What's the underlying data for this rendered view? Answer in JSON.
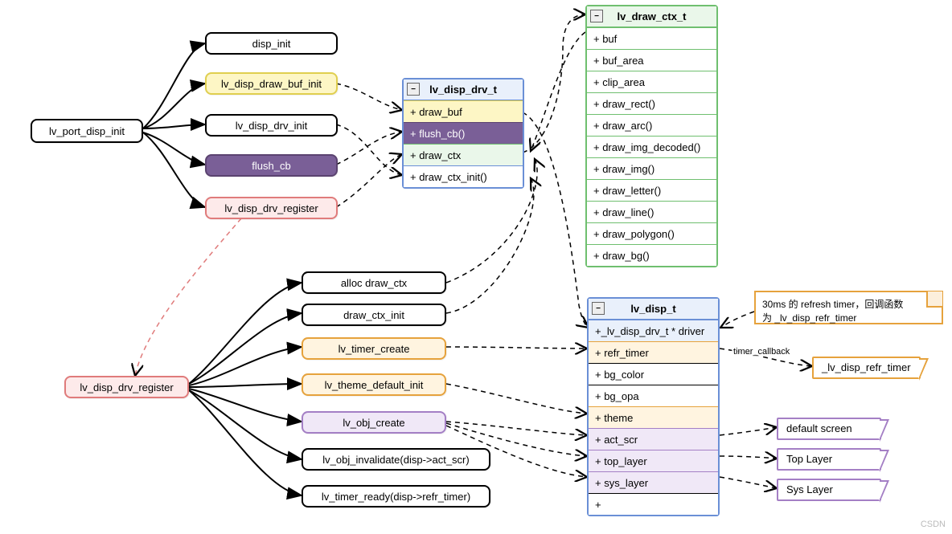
{
  "left_root": "lv_port_disp_init",
  "left_children": [
    {
      "label": "disp_init",
      "fill": "#fff",
      "border": "#000"
    },
    {
      "label": "lv_disp_draw_buf_init",
      "fill": "#fdf6c5",
      "border": "#e0cf4f"
    },
    {
      "label": "lv_disp_drv_init",
      "fill": "#fff",
      "border": "#000"
    },
    {
      "label": "flush_cb",
      "fill": "#7a5f97",
      "border": "#5b4370",
      "text": "#fff"
    },
    {
      "label": "lv_disp_drv_register",
      "fill": "#fdeaea",
      "border": "#e07b7b"
    }
  ],
  "drv_class": {
    "title": "lv_disp_drv_t",
    "border": "#6a8fd6",
    "rows": [
      {
        "label": "+ draw_buf",
        "fill": "#fdf6c5",
        "border": "#e0cf4f"
      },
      {
        "label": "+ flush_cb()",
        "fill": "#7a5f97",
        "border": "#5b4370",
        "text": "#fff"
      },
      {
        "label": "+ draw_ctx",
        "fill": "#eaf7ea",
        "border": "#6fbf6f"
      },
      {
        "label": "+ draw_ctx_init()",
        "fill": "#fff",
        "border": "#6a8fd6"
      }
    ]
  },
  "draw_ctx_class": {
    "title": "lv_draw_ctx_t",
    "border": "#6fbf6f",
    "rows": [
      "+ buf",
      "+ buf_area",
      "+ clip_area",
      "+ draw_rect()",
      "+ draw_arc()",
      "+ draw_img_decoded()",
      "+ draw_img()",
      "+ draw_letter()",
      "+ draw_line()",
      "+ draw_polygon()",
      "+ draw_bg()"
    ]
  },
  "reg_node": "lv_disp_drv_register",
  "reg_children": [
    {
      "label": "alloc draw_ctx",
      "fill": "#fff",
      "border": "#000"
    },
    {
      "label": "draw_ctx_init",
      "fill": "#fff",
      "border": "#000"
    },
    {
      "label": "lv_timer_create",
      "fill": "#fff4e0",
      "border": "#e6a23c"
    },
    {
      "label": "lv_theme_default_init",
      "fill": "#fff4e0",
      "border": "#e6a23c"
    },
    {
      "label": "lv_obj_create",
      "fill": "#f0e8f7",
      "border": "#a47fc5"
    },
    {
      "label": "lv_obj_invalidate(disp->act_scr)",
      "fill": "#fff",
      "border": "#000"
    },
    {
      "label": "lv_timer_ready(disp->refr_timer)",
      "fill": "#fff",
      "border": "#000"
    }
  ],
  "disp_class": {
    "title": "lv_disp_t",
    "border": "#6a8fd6",
    "rows": [
      {
        "label": "+_lv_disp_drv_t * driver",
        "fill": "#e9f0fb",
        "border": "#6a8fd6"
      },
      {
        "label": "+ refr_timer",
        "fill": "#fff4e0",
        "border": "#e6a23c"
      },
      {
        "label": "+ bg_color",
        "fill": "#fff",
        "border": "#000"
      },
      {
        "label": "+ bg_opa",
        "fill": "#fff",
        "border": "#000"
      },
      {
        "label": "+ theme",
        "fill": "#fff4e0",
        "border": "#e6a23c"
      },
      {
        "label": "+ act_scr",
        "fill": "#f0e8f7",
        "border": "#a47fc5"
      },
      {
        "label": "+ top_layer",
        "fill": "#f0e8f7",
        "border": "#a47fc5"
      },
      {
        "label": "+ sys_layer",
        "fill": "#f0e8f7",
        "border": "#a47fc5"
      },
      {
        "label": "+",
        "fill": "#fff",
        "border": "#000"
      }
    ]
  },
  "note": {
    "line1": "30ms 的 refresh timer，回调函数",
    "line2": "为 _lv_disp_refr_timer"
  },
  "timer_cb_label": "timer_callback",
  "refr_timer_tag": {
    "label": "_lv_disp_refr_timer",
    "border": "#e6a23c"
  },
  "layer_tags": [
    {
      "label": "default screen",
      "border": "#a47fc5"
    },
    {
      "label": "Top Layer",
      "border": "#a47fc5"
    },
    {
      "label": "Sys Layer",
      "border": "#a47fc5"
    }
  ],
  "watermark": "CSDN"
}
